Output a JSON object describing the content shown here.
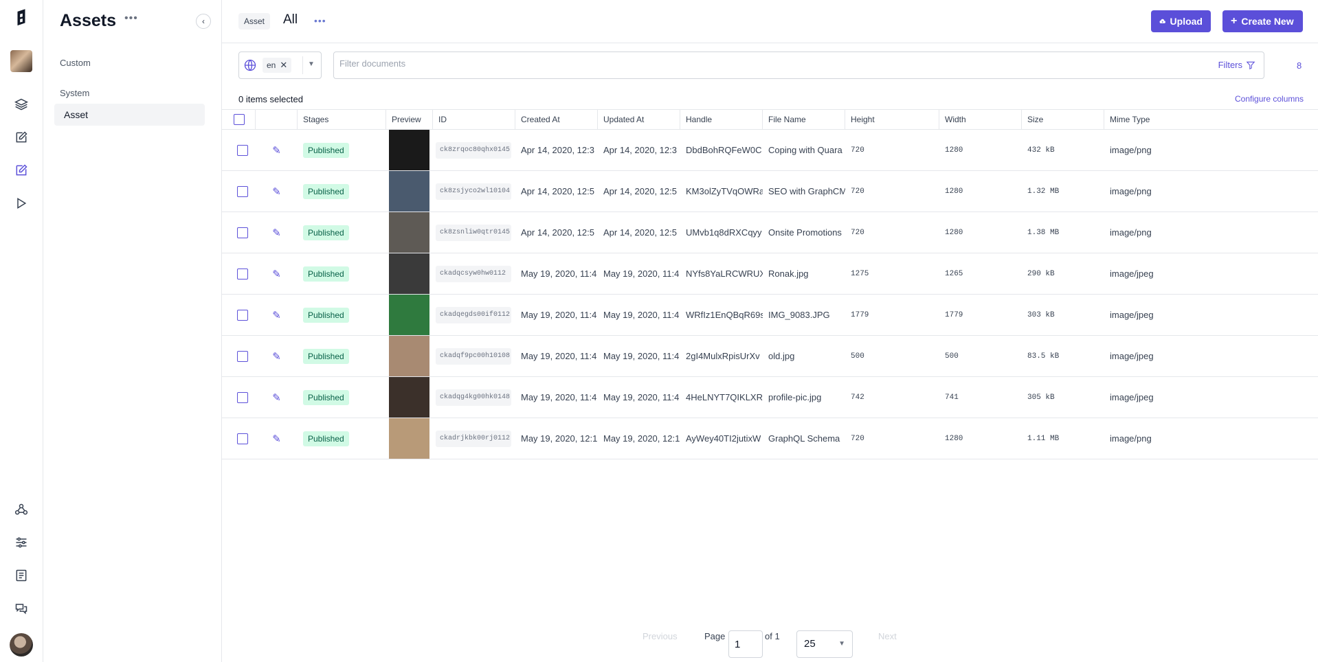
{
  "sidebar": {
    "title": "Assets",
    "more": "•••",
    "collapse": "‹",
    "groups": [
      {
        "label": "Custom"
      },
      {
        "label": "System"
      }
    ],
    "active_item": "Asset"
  },
  "header": {
    "breadcrumb": "Asset",
    "view_title": "All",
    "more": "•••",
    "upload_label": "Upload",
    "create_label": "Create New"
  },
  "filter": {
    "locale": "en",
    "placeholder": "Filter documents",
    "filters_label": "Filters",
    "count": "8"
  },
  "selection": {
    "text": "0 items selected",
    "configure": "Configure columns"
  },
  "table": {
    "columns": [
      "Stages",
      "Preview",
      "ID",
      "Created At",
      "Updated At",
      "Handle",
      "File Name",
      "Height",
      "Width",
      "Size",
      "Mime Type"
    ],
    "rows": [
      {
        "stage": "Published",
        "id": "ck8zrqoc80qhx0145",
        "created": "Apr 14, 2020, 12:3",
        "updated": "Apr 14, 2020, 12:3",
        "handle": "DbdBohRQFeW0C",
        "file": "Coping with Quara",
        "height": "720",
        "width": "1280",
        "size": "432 kB",
        "mime": "image/png",
        "thumb": "#1a1a1a"
      },
      {
        "stage": "Published",
        "id": "ck8zsjyco2wl10104",
        "created": "Apr 14, 2020, 12:5",
        "updated": "Apr 14, 2020, 12:5",
        "handle": "KM3olZyTVqOWRa",
        "file": "SEO with GraphCM",
        "height": "720",
        "width": "1280",
        "size": "1.32 MB",
        "mime": "image/png",
        "thumb": "#4a5a6e"
      },
      {
        "stage": "Published",
        "id": "ck8zsnliw0qtr0145",
        "created": "Apr 14, 2020, 12:5",
        "updated": "Apr 14, 2020, 12:5",
        "handle": "UMvb1q8dRXCqyy",
        "file": "Onsite Promotions",
        "height": "720",
        "width": "1280",
        "size": "1.38 MB",
        "mime": "image/png",
        "thumb": "#5e5a55"
      },
      {
        "stage": "Published",
        "id": "ckadqcsyw0hw0112",
        "created": "May 19, 2020, 11:4",
        "updated": "May 19, 2020, 11:4",
        "handle": "NYfs8YaLRCWRUX",
        "file": "Ronak.jpg",
        "height": "1275",
        "width": "1265",
        "size": "290 kB",
        "mime": "image/jpeg",
        "thumb": "#3a3a3a"
      },
      {
        "stage": "Published",
        "id": "ckadqegds00if0112",
        "created": "May 19, 2020, 11:4",
        "updated": "May 19, 2020, 11:4",
        "handle": "WRfIz1EnQBqR69s",
        "file": "IMG_9083.JPG",
        "height": "1779",
        "width": "1779",
        "size": "303 kB",
        "mime": "image/jpeg",
        "thumb": "#2f7a3e"
      },
      {
        "stage": "Published",
        "id": "ckadqf9pc00h10108",
        "created": "May 19, 2020, 11:4",
        "updated": "May 19, 2020, 11:4",
        "handle": "2gI4MulxRpisUrXv",
        "file": "old.jpg",
        "height": "500",
        "width": "500",
        "size": "83.5 kB",
        "mime": "image/jpeg",
        "thumb": "#a88a72"
      },
      {
        "stage": "Published",
        "id": "ckadqg4kg00hk0148",
        "created": "May 19, 2020, 11:4",
        "updated": "May 19, 2020, 11:4",
        "handle": "4HeLNYT7QIKLXR",
        "file": "profile-pic.jpg",
        "height": "742",
        "width": "741",
        "size": "305 kB",
        "mime": "image/jpeg",
        "thumb": "#3b302a"
      },
      {
        "stage": "Published",
        "id": "ckadrjkbk00rj0112",
        "created": "May 19, 2020, 12:1",
        "updated": "May 19, 2020, 12:1",
        "handle": "AyWey40TI2jutixW",
        "file": "GraphQL Schema",
        "height": "720",
        "width": "1280",
        "size": "1.11 MB",
        "mime": "image/png",
        "thumb": "#b89a78"
      }
    ]
  },
  "pagination": {
    "previous": "Previous",
    "page_label": "Page",
    "page": "1",
    "of": "of 1",
    "page_size": "25",
    "next": "Next"
  },
  "colors": {
    "accent": "#5b4fd9",
    "published_bg": "#d1fae5",
    "published_fg": "#065f46"
  }
}
